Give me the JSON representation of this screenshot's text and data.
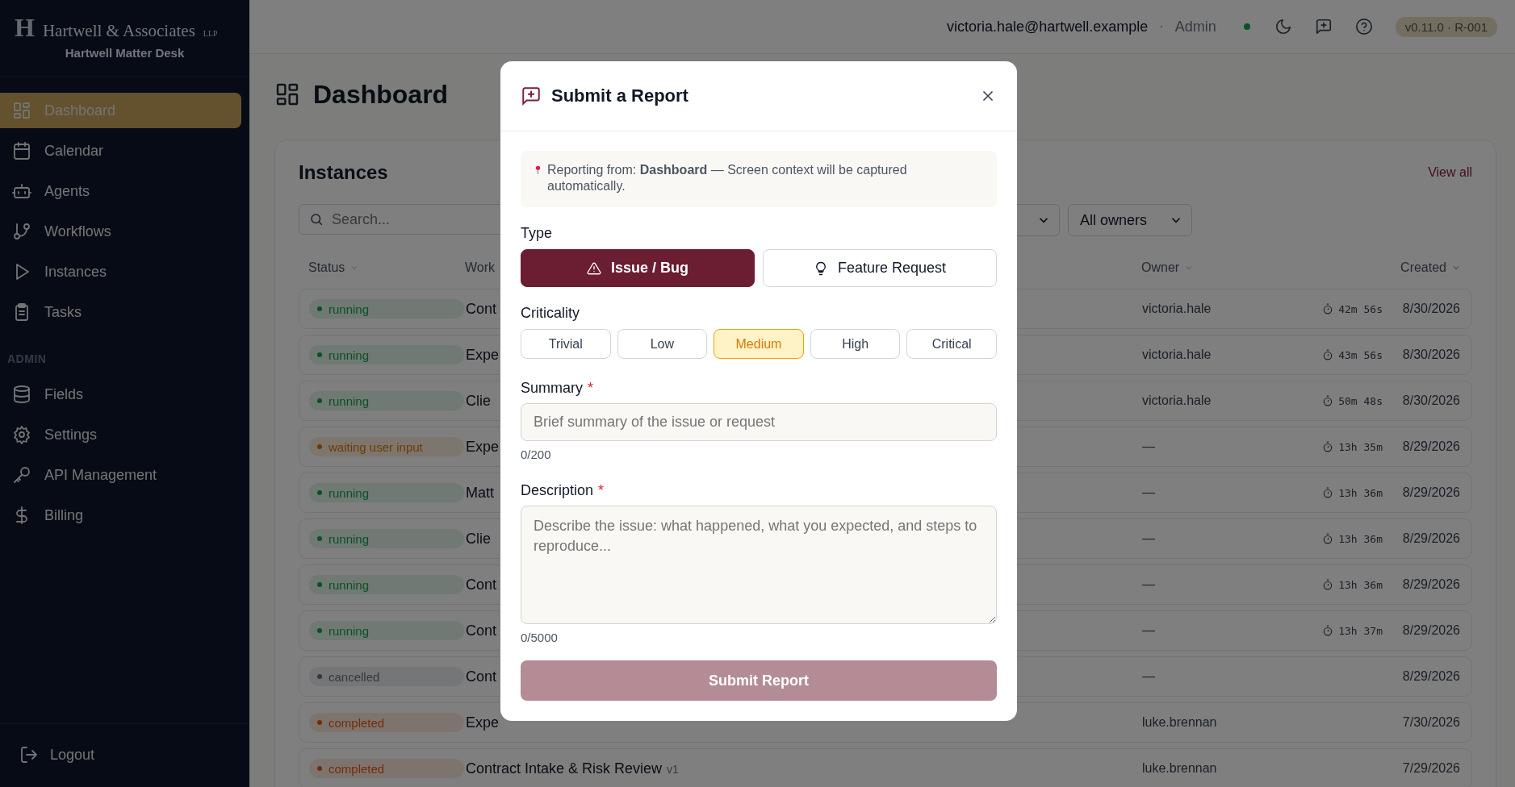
{
  "brand": {
    "name": "Hartwell & Associates",
    "suffix": "LLP",
    "app": "Hartwell Matter Desk",
    "mark": "H"
  },
  "sidebar": {
    "items": [
      {
        "label": "Dashboard",
        "selected": true
      },
      {
        "label": "Calendar",
        "selected": false
      },
      {
        "label": "Agents",
        "selected": false
      },
      {
        "label": "Workflows",
        "selected": false
      },
      {
        "label": "Instances",
        "selected": false
      },
      {
        "label": "Tasks",
        "selected": false
      }
    ],
    "section": "ADMIN",
    "admin_items": [
      {
        "label": "Fields",
        "selected": false
      },
      {
        "label": "Settings",
        "selected": false
      },
      {
        "label": "API Management",
        "selected": false
      },
      {
        "label": "Billing",
        "selected": false
      }
    ],
    "logout": "Logout"
  },
  "header": {
    "user": "victoria.hale@hartwell.example",
    "separator": "·",
    "role": "Admin",
    "version": "v0.11.0 · R-001"
  },
  "page": {
    "title": "Dashboard"
  },
  "instances": {
    "title": "Instances",
    "view_all": "View all",
    "search": {
      "placeholder": "Search..."
    },
    "owner_filter": "All owners",
    "columns": [
      "Status",
      "Work",
      "Owner",
      "Created"
    ],
    "rows": [
      {
        "status": "running",
        "kind": "running",
        "workflow": "Cont",
        "owner": "victoria.hale",
        "duration": "42m 56s",
        "created": "8/30/2026"
      },
      {
        "status": "running",
        "kind": "running",
        "workflow": "Expe",
        "owner": "victoria.hale",
        "duration": "43m 56s",
        "created": "8/30/2026"
      },
      {
        "status": "running",
        "kind": "running",
        "workflow": "Clie",
        "owner": "victoria.hale",
        "duration": "50m 48s",
        "created": "8/30/2026"
      },
      {
        "status": "waiting user input",
        "kind": "waiting",
        "workflow": "Expe",
        "owner": "—",
        "duration": "13h 35m",
        "created": "8/29/2026"
      },
      {
        "status": "running",
        "kind": "running",
        "workflow": "Matt",
        "owner": "—",
        "duration": "13h 36m",
        "created": "8/29/2026"
      },
      {
        "status": "running",
        "kind": "running",
        "workflow": "Clie",
        "owner": "—",
        "duration": "13h 36m",
        "created": "8/29/2026"
      },
      {
        "status": "running",
        "kind": "running",
        "workflow": "Cont",
        "owner": "—",
        "duration": "13h 36m",
        "created": "8/29/2026"
      },
      {
        "status": "running",
        "kind": "running",
        "workflow": "Cont",
        "owner": "—",
        "duration": "13h 37m",
        "created": "8/29/2026"
      },
      {
        "status": "cancelled",
        "kind": "cancelled",
        "workflow": "Cont",
        "owner": "—",
        "created": "8/29/2026"
      },
      {
        "status": "completed",
        "kind": "completed",
        "workflow": "Expe",
        "owner": "luke.brennan",
        "created": "7/30/2026"
      },
      {
        "status": "completed",
        "kind": "completed",
        "workflow": "Contract Intake & Risk Review",
        "version": "v1",
        "owner": "luke.brennan",
        "created": "7/29/2026"
      }
    ]
  },
  "modal": {
    "title": "Submit a Report",
    "context": "Reporting from: **Dashboard**  — Screen context will be captured automatically.",
    "type_label": "Type",
    "types": [
      {
        "label": "Issue / Bug",
        "kind": "bug",
        "selected": true
      },
      {
        "label": "Feature Request",
        "kind": "feature",
        "selected": false
      }
    ],
    "criticality_label": "Criticality",
    "criticality": [
      {
        "label": "Trivial",
        "selected": false
      },
      {
        "label": "Low",
        "selected": false
      },
      {
        "label": "Medium",
        "selected": true
      },
      {
        "label": "High",
        "selected": false
      },
      {
        "label": "Critical",
        "selected": false
      }
    ],
    "summary": {
      "label": "Summary",
      "required": "*",
      "placeholder": "Brief summary of the issue or request",
      "counter": "0/200"
    },
    "description": {
      "label": "Description",
      "required": "*",
      "placeholder": "Describe the issue: what happened, what you expected, and steps to reproduce...",
      "counter": "0/5000"
    },
    "submit": {
      "label": "Submit Report",
      "disabled": true
    }
  }
}
